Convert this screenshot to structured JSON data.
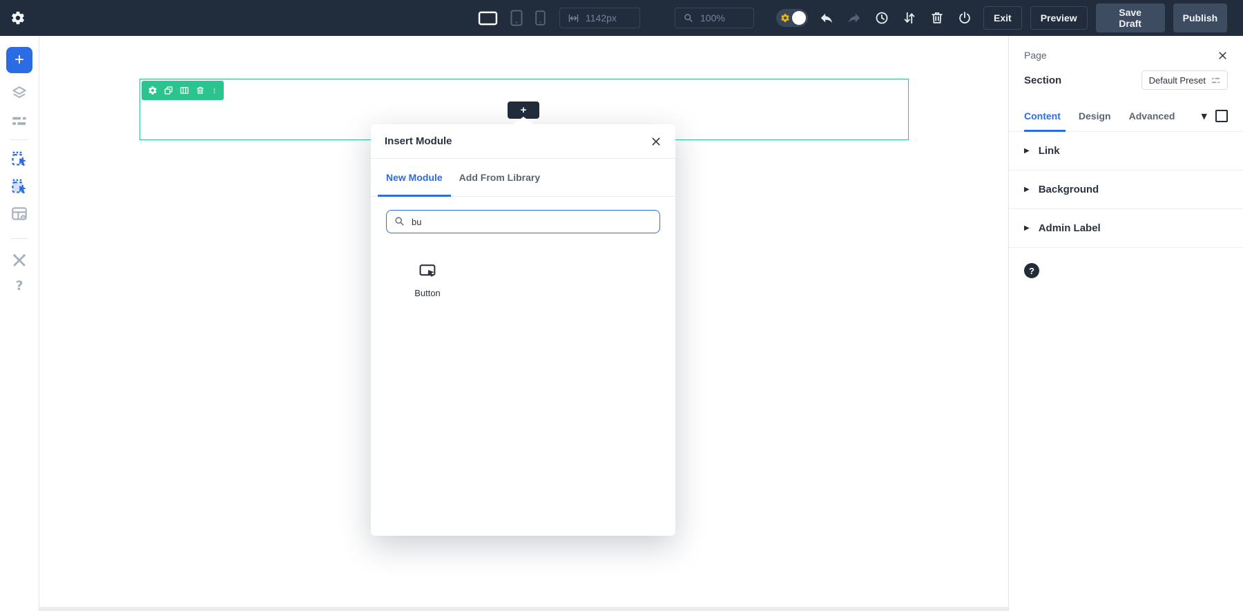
{
  "topbar": {
    "width_value": "1142px",
    "zoom_value": "100%",
    "exit_label": "Exit",
    "preview_label": "Preview",
    "save_draft_label": "Save Draft",
    "publish_label": "Publish"
  },
  "sidebar": {
    "add_glyph": "+",
    "help_glyph": "?"
  },
  "canvas": {
    "add_glyph": "+"
  },
  "modal": {
    "title": "Insert Module",
    "tabs": [
      {
        "label": "New Module",
        "active": true
      },
      {
        "label": "Add From Library",
        "active": false
      }
    ],
    "search_value": "bu",
    "modules": [
      {
        "label": "Button"
      }
    ]
  },
  "panel": {
    "title": "Page",
    "element_label": "Section",
    "preset_label": "Default Preset",
    "tabs": [
      {
        "label": "Content",
        "active": true
      },
      {
        "label": "Design",
        "active": false
      },
      {
        "label": "Advanced",
        "active": false
      }
    ],
    "accordions": [
      {
        "label": "Link"
      },
      {
        "label": "Background"
      },
      {
        "label": "Admin Label"
      }
    ],
    "help_glyph": "?"
  },
  "icons": {
    "caret_down": "▼",
    "caret_right": "▶"
  },
  "colors": {
    "topbar_bg": "#212C3D",
    "accent_blue": "#2B6BE4",
    "section_green": "#2BC48F",
    "toggle_yellow": "#F0B50A"
  }
}
